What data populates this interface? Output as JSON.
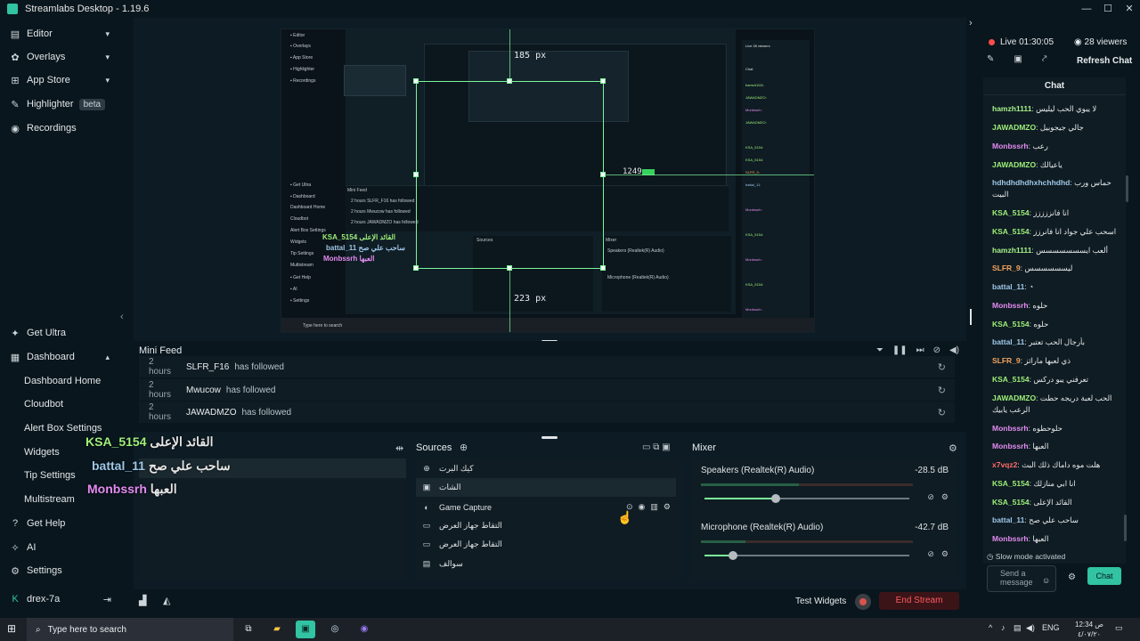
{
  "window": {
    "title": "Streamlabs Desktop - 1.19.6"
  },
  "sidebar": {
    "top_items": [
      {
        "label": "Editor"
      },
      {
        "label": "Overlays"
      },
      {
        "label": "App Store"
      },
      {
        "label": "Highlighter",
        "badge": "beta"
      },
      {
        "label": "Recordings"
      }
    ],
    "bottom_items": [
      {
        "label": "Get Ultra"
      },
      {
        "label": "Dashboard"
      },
      {
        "label": "Dashboard Home"
      },
      {
        "label": "Cloudbot"
      },
      {
        "label": "Alert Box Settings"
      },
      {
        "label": "Widgets"
      },
      {
        "label": "Tip Settings"
      },
      {
        "label": "Multistream"
      },
      {
        "label": "Get Help"
      },
      {
        "label": "AI"
      },
      {
        "label": "Settings"
      },
      {
        "label": "drex-7a"
      }
    ]
  },
  "preview": {
    "measure_top": "185 px",
    "measure_bottom": "223 px",
    "fps": "1249"
  },
  "minifeed": {
    "title": "Mini Feed",
    "rows": [
      {
        "time": "2 hours",
        "name": "SLFR_F16",
        "action": "has followed"
      },
      {
        "time": "2 hours",
        "name": "Mwucow",
        "action": "has followed"
      },
      {
        "time": "2 hours",
        "name": "JAWADMZO",
        "action": "has followed"
      }
    ]
  },
  "overlay_text": [
    {
      "name": "KSA_5154",
      "msg": "القائد الإعلى",
      "color": "#9ef07a"
    },
    {
      "name": "battal_11",
      "msg": "ساحب علي صح",
      "color": "#9ec7e8"
    },
    {
      "name": "Monbssrh",
      "msg": "العبها",
      "color": "#e38cf2"
    }
  ],
  "sources": {
    "title": "Sources",
    "items": [
      {
        "label": "كيك البرت",
        "icon": "globe"
      },
      {
        "label": "الشات",
        "icon": "chat"
      },
      {
        "label": "Game Capture",
        "icon": "gamepad"
      },
      {
        "label": "التقاط جهاز العرض",
        "icon": "monitor"
      },
      {
        "label": "التقاط جهاز العرض",
        "icon": "monitor"
      },
      {
        "label": "سوالف",
        "icon": "file"
      }
    ]
  },
  "mixer": {
    "title": "Mixer",
    "channels": [
      {
        "name": "Speakers (Realtek(R) Audio)",
        "db": "-28.5 dB",
        "level": 0.35
      },
      {
        "name": "Microphone (Realtek(R) Audio)",
        "db": "-42.7 dB",
        "level": 0.14
      }
    ]
  },
  "footer": {
    "test_widgets": "Test Widgets",
    "end_stream": "End Stream"
  },
  "stream": {
    "live": "Live 01:30:05",
    "viewers": "28 viewers",
    "refresh": "Refresh Chat"
  },
  "chat": {
    "title": "Chat",
    "messages": [
      {
        "user": "hamzh1111",
        "text": "لا يبوي الحب ليليس",
        "color": "#a6f08a"
      },
      {
        "user": "JAWADMZO",
        "text": "جالي جيجوبيل",
        "color": "#9ef07a"
      },
      {
        "user": "Monbssrh",
        "text": "رعب",
        "color": "#e38cf2"
      },
      {
        "user": "JAWADMZO",
        "text": "ياعيالك",
        "color": "#9ef07a"
      },
      {
        "user": "hdhdhdhdhxhchhdhd",
        "text": "حماس ورب",
        "color": "#9ec7e8"
      },
      {
        "user": "",
        "text": "البيت",
        "color": "#9ec7e8"
      },
      {
        "user": "KSA_5154",
        "text": "انا فانززززز",
        "color": "#9ef07a"
      },
      {
        "user": "KSA_5154",
        "text": "اسحب علي جواد انا فانرزز",
        "color": "#9ef07a"
      },
      {
        "user": "hamzh1111",
        "text": "ألعب ايسسسسسسس",
        "color": "#a6f08a"
      },
      {
        "user": "SLFR_9",
        "text": "ليسسسسسس",
        "color": "#f2a35c"
      },
      {
        "user": "battal_11",
        "text": "",
        "color": "#9ec7e8"
      },
      {
        "user": "Monbssrh",
        "text": "حلوه",
        "color": "#e38cf2"
      },
      {
        "user": "KSA_5154",
        "text": "حلوه",
        "color": "#9ef07a"
      },
      {
        "user": "battal_11",
        "text": "بأرجال الحب تعتبر",
        "color": "#9ec7e8"
      },
      {
        "user": "SLFR_9",
        "text": "ذي لعبها ماراثز",
        "color": "#f2a35c"
      },
      {
        "user": "KSA_5154",
        "text": "تعرفني يبو دركس",
        "color": "#9ef07a"
      },
      {
        "user": "JAWADMZO",
        "text": "الحب لعبة دريجه حطت",
        "color": "#9ef07a"
      },
      {
        "user": "",
        "text": "الرعب يابيك",
        "color": "#9ef07a"
      },
      {
        "user": "Monbssrh",
        "text": "حلوحطوه",
        "color": "#e38cf2"
      },
      {
        "user": "Monbssrh",
        "text": "العبها",
        "color": "#e38cf2"
      },
      {
        "user": "x7vqz2",
        "text": "هلت موه داماك ذلك البث",
        "color": "#ff6b6b"
      },
      {
        "user": "KSA_5154",
        "text": "انا ابي منازلك",
        "color": "#9ef07a"
      },
      {
        "user": "KSA_5154",
        "text": "القائد الإعلى",
        "color": "#9ef07a"
      },
      {
        "user": "battal_11",
        "text": "ساحب علي صح",
        "color": "#9ec7e8"
      },
      {
        "user": "Monbssrh",
        "text": "العبها",
        "color": "#e38cf2"
      }
    ],
    "slow_mode": "Slow mode activated",
    "placeholder": "Send a message",
    "button": "Chat"
  },
  "taskbar": {
    "search": "Type here to search",
    "lang": "ENG",
    "time": "12:34 ص",
    "date": "٤/٠٧/٢٠"
  },
  "icons": {
    "accent": "#31c3a2"
  }
}
